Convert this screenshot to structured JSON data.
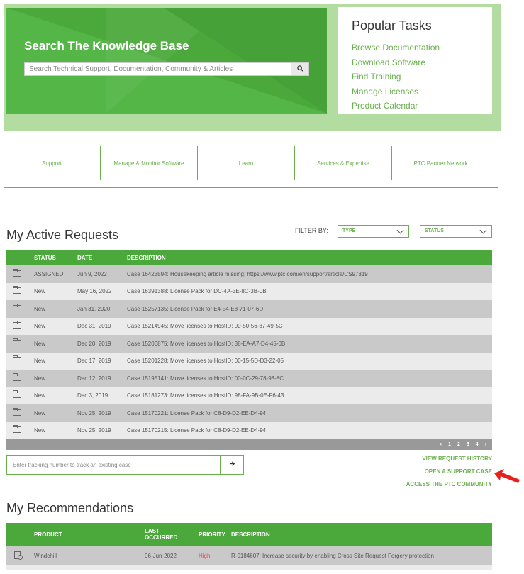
{
  "hero": {
    "search_title": "Search The Knowledge Base",
    "search_placeholder": "Search Technical Support, Documentation, Community & Articles",
    "search_icon": "search-icon",
    "popular_title": "Popular Tasks",
    "popular_tasks": [
      "Browse Documentation",
      "Download Software",
      "Find Training",
      "Manage Licenses",
      "Product Calendar"
    ]
  },
  "nav": [
    "Support",
    "Manage & Monitor Software",
    "Learn",
    "Services & Expertise",
    "PTC Partner Network"
  ],
  "active_requests": {
    "title": "My Active Requests",
    "filter_label": "FILTER BY:",
    "filter_type": "TYPE",
    "filter_status": "STATUS",
    "columns": {
      "status": "STATUS",
      "date": "DATE",
      "description": "DESCRIPTION"
    },
    "rows": [
      {
        "status": "ASSIGNED",
        "date": "Jun 9, 2022",
        "description": "Case 16423594: Housekeeping article missing: https://www.ptc.com/en/support/article/CS97319"
      },
      {
        "status": "New",
        "date": "May 16, 2022",
        "description": "Case 16391388: License Pack for DC-4A-3E-8C-3B-0B"
      },
      {
        "status": "New",
        "date": "Jan 31, 2020",
        "description": "Case 15257135: License Pack for E4-54-E8-71-07-6D"
      },
      {
        "status": "New",
        "date": "Dec 31, 2019",
        "description": "Case 15214945: Move licenses to HostID: 00-50-56-87-49-5C"
      },
      {
        "status": "New",
        "date": "Dec 20, 2019",
        "description": "Case 15206875: Move licenses to HostID: 38-EA-A7-D4-45-0B"
      },
      {
        "status": "New",
        "date": "Dec 17, 2019",
        "description": "Case 15201228: Move licenses to HostID: 00-15-5D-D3-22-05"
      },
      {
        "status": "New",
        "date": "Dec 12, 2019",
        "description": "Case 15195141: Move licenses to HostID: 00-0C-29-78-98-8C"
      },
      {
        "status": "New",
        "date": "Dec 3, 2019",
        "description": "Case 15181273: Move licenses to HostID: 98-FA-9B-0E-F6-43"
      },
      {
        "status": "New",
        "date": "Nov 25, 2019",
        "description": "Case 15170221: License Pack for C8-D9-D2-EE-D4-94"
      },
      {
        "status": "New",
        "date": "Nov 25, 2019",
        "description": "Case 15170215: License Pack for C8-D9-D2-EE-D4-94"
      }
    ],
    "pagination": {
      "prev": "‹",
      "pages": [
        "1",
        "2",
        "3",
        "4"
      ],
      "next": "›"
    },
    "track_placeholder": "Enter tracking number to track an existing case",
    "track_icon": "arrow-right-icon",
    "links": {
      "history": "VIEW REQUEST HISTORY",
      "open_case": "OPEN A SUPPORT CASE",
      "community": "ACCESS THE PTC COMMUNITY"
    }
  },
  "recommendations": {
    "title": "My Recommendations",
    "columns": {
      "product": "PRODUCT",
      "occurred_line1": "LAST",
      "occurred_line2": "OCCURRED",
      "priority": "PRIORITY",
      "description": "DESCRIPTION"
    },
    "rows": [
      {
        "product": "Windchill",
        "occurred": "06-Jun-2022",
        "priority": "High",
        "description": "R-0184607: Increase security by enabling Cross Site Request Forgery protection"
      }
    ]
  },
  "colors": {
    "accent": "#6ab04c",
    "header_green": "#4ba93c",
    "hero_bg": "#b2dca0",
    "pointer": "#e8201b"
  }
}
